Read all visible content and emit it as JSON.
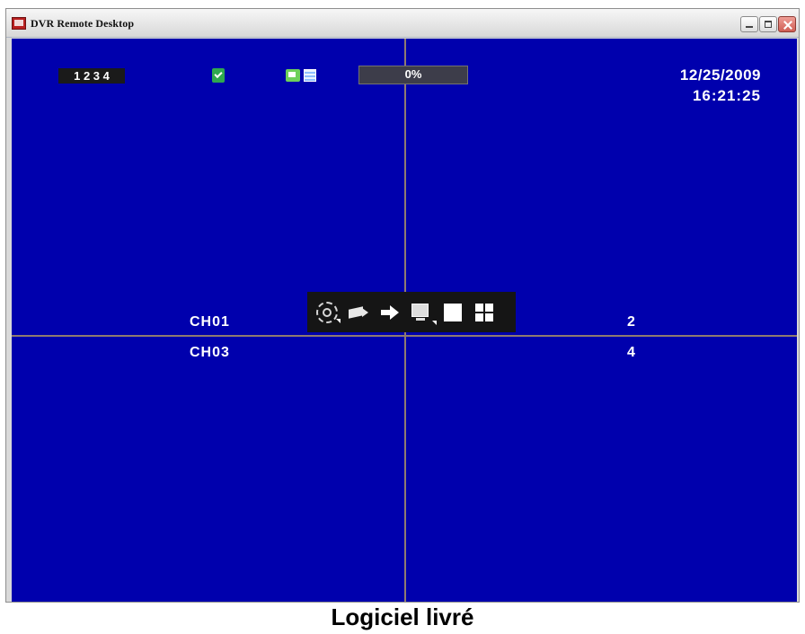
{
  "window": {
    "title": "DVR Remote Desktop"
  },
  "top_bar": {
    "channel_indicators": "1 2 3 4",
    "progress_value": 0,
    "progress_label": "0%",
    "date": "12/25/2009",
    "time": "16:21:25"
  },
  "channels": {
    "ch1": "CH01",
    "ch2": "2",
    "ch3": "CH03",
    "ch4": "4"
  },
  "toolbar": {
    "icons": [
      "gear-icon",
      "camera-icon",
      "arrow-icon",
      "display-icon",
      "single-view-icon",
      "quad-view-icon"
    ]
  },
  "caption": "Logiciel livré",
  "colors": {
    "screen_background": "#0000ad",
    "grid_line": "#8f7b70",
    "toolbar_background": "#151515",
    "title_bar_background": "#e6e6e6"
  }
}
